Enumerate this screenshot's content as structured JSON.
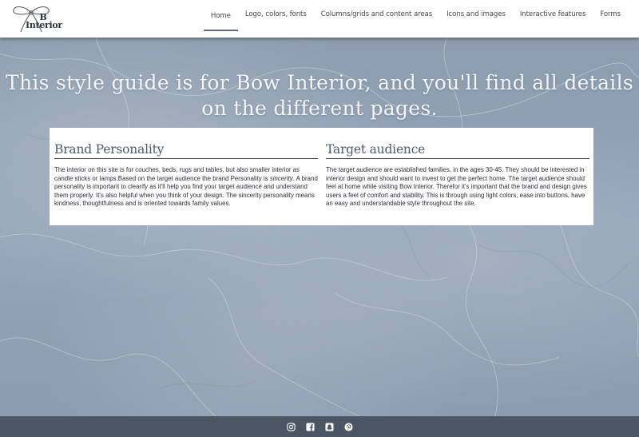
{
  "header": {
    "logo_top": "B",
    "logo_bottom": "Interior",
    "nav": [
      {
        "label": "Home",
        "active": true
      },
      {
        "label": "Logo, colors, fonts"
      },
      {
        "label": "Columns/grids and content areas"
      },
      {
        "label": "Icons and images"
      },
      {
        "label": "Interactive features"
      },
      {
        "label": "Forms"
      }
    ]
  },
  "hero": {
    "title": "This style guide is for Bow Interior, and you'll find all details on the different pages."
  },
  "sections": {
    "brand": {
      "heading": "Brand Personality",
      "text_before": "The interior on this site is for couches, beds, rugs and tables, but also smaller interior as candle sticks or lamps.Based on the target audience the brand Personality is ",
      "emphasis": "sincerity",
      "text_after": ". A brand personality is important to clearify as it'll help you find your target audience and understand them properly. It's also helpful when you think of your design. The sincerity personality means kindness, thoughtfulness and is oriented towards family values."
    },
    "audience": {
      "heading": "Target audience",
      "text": "The target audience are established families, in the ages 30-45. They should be interested in interior design and should want to invest to get the perfect home. The target audience should feel at home while visiting Bow Interior. Therefor it's important that the brand and design gives users a feel of comfort and stability. This is through using light colors, ease into buttons, have an easy and understandable style throughout the site."
    }
  },
  "footer": {
    "icons": [
      "instagram-icon",
      "facebook-icon",
      "snapchat-icon",
      "pinterest-icon"
    ]
  },
  "colors": {
    "footer_bg": "#4a5663",
    "heading": "#4d5b6c",
    "hero_text": "#f4f6f9"
  }
}
